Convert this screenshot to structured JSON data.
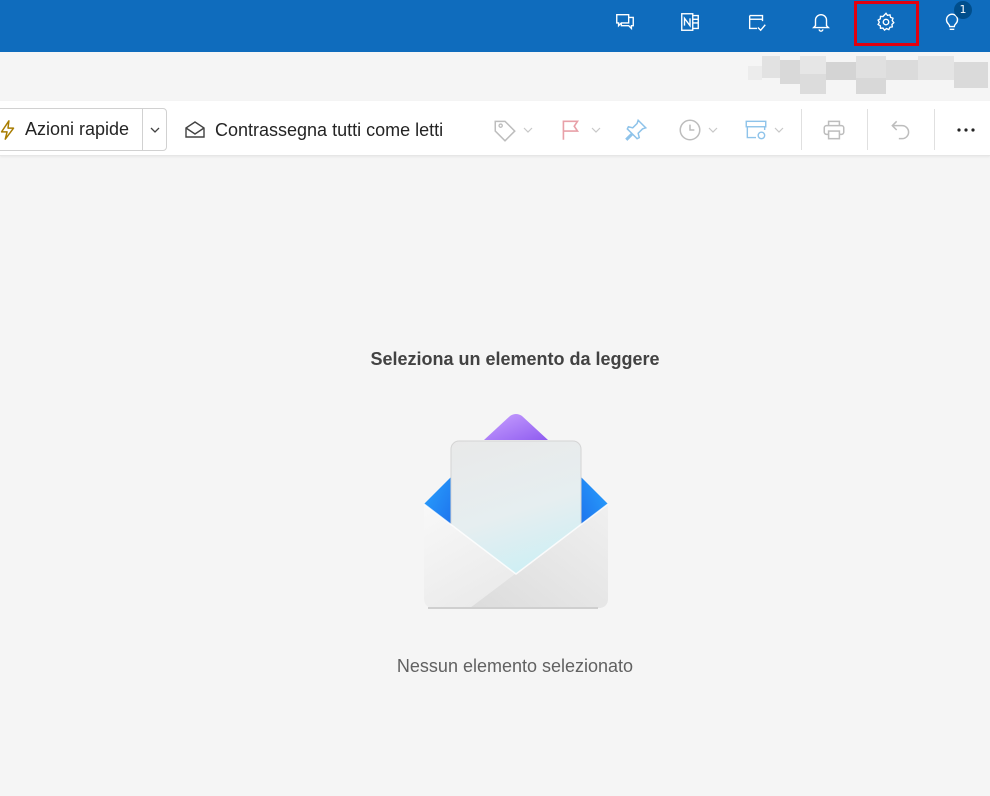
{
  "topbar": {
    "color": "#0f6cbd",
    "icons": [
      {
        "name": "chat-feedback-icon"
      },
      {
        "name": "onenote-icon"
      },
      {
        "name": "tasks-icon"
      },
      {
        "name": "bell-icon"
      },
      {
        "name": "gear-icon",
        "highlighted": true
      },
      {
        "name": "lightbulb-icon",
        "badge": "1"
      }
    ]
  },
  "toolbar": {
    "quick_actions_label": "Azioni rapide",
    "mark_all_read_label": "Contrassegna tutti come letti",
    "tools": [
      "tag-icon",
      "flag-icon",
      "pin-icon",
      "clock-icon",
      "rules-icon",
      "print-icon",
      "undo-icon",
      "more-icon"
    ]
  },
  "main": {
    "empty_title": "Seleziona un elemento da leggere",
    "empty_subtitle": "Nessun elemento selezionato"
  }
}
